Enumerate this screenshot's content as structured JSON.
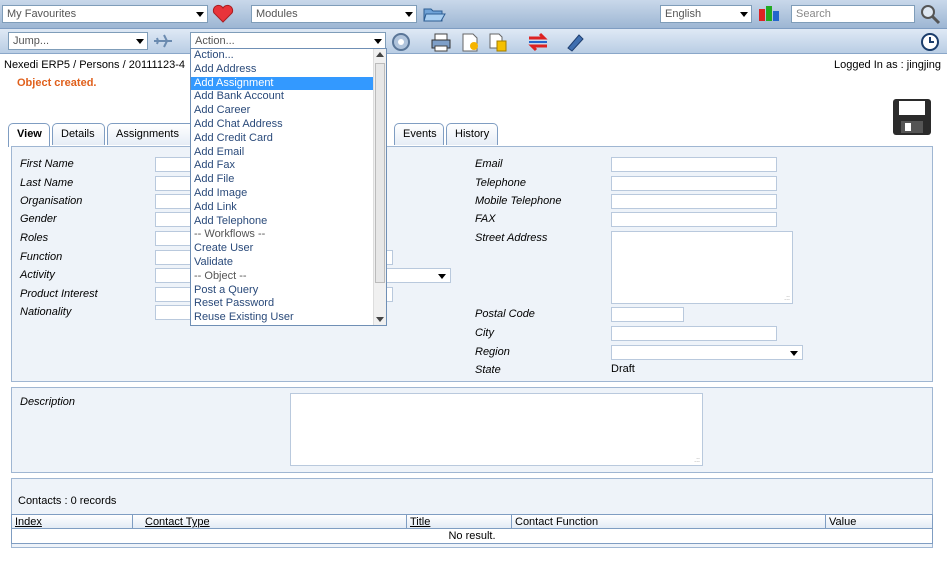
{
  "topbar": {
    "favourites": "My Favourites",
    "modules": "Modules",
    "language": "English",
    "search_placeholder": "Search"
  },
  "toolbar": {
    "jump": "Jump...",
    "action": "Action..."
  },
  "breadcrumb": "Nexedi ERP5 / Persons / 20111123-4",
  "message": "Object created.",
  "logged_in": "Logged In as : jingjing",
  "tabs": [
    "View",
    "Details",
    "Assignments",
    "Events",
    "History"
  ],
  "action_menu": [
    "Action...",
    "Add Address",
    "Add Assignment",
    "Add Bank Account",
    "Add Career",
    "Add Chat Address",
    "Add Credit Card",
    "Add Email",
    "Add Fax",
    "Add File",
    "Add Image",
    "Add Link",
    "Add Telephone",
    "-- Workflows --",
    "Create User",
    "Validate",
    "-- Object --",
    "Post a Query",
    "Reset Password",
    "Reuse Existing User"
  ],
  "action_menu_selected": "Add Assignment",
  "left_fields": [
    "First Name",
    "Last Name",
    "Organisation",
    "Gender",
    "Roles",
    "Function",
    "Activity",
    "Product Interest",
    "Nationality"
  ],
  "right_fields": {
    "email": "Email",
    "telephone": "Telephone",
    "mobile": "Mobile Telephone",
    "fax": "FAX",
    "street": "Street Address",
    "postal": "Postal Code",
    "city": "City",
    "region": "Region",
    "state": "State",
    "state_value": "Draft"
  },
  "description_label": "Description",
  "contacts": {
    "title": "Contacts : 0 records",
    "columns": [
      "Index",
      "Contact Type",
      "Title",
      "Contact Function",
      "Value"
    ],
    "empty": "No result."
  },
  "colors": {
    "accent": "#3399ff",
    "message": "#e0601c",
    "panel": "#eef3f9"
  }
}
